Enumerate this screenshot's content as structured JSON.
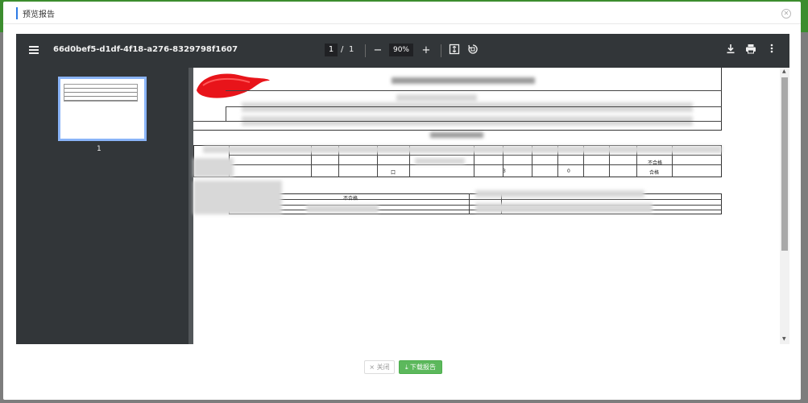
{
  "modal": {
    "title": "预览报告",
    "close_icon": "close-circle-icon"
  },
  "viewer": {
    "filename": "66d0bef5-d1df-4f18-a276-8329798f1607",
    "current_page": "1",
    "page_separator": "/",
    "total_pages": "1",
    "zoom": "90%",
    "thumbnail_label": "1",
    "icons": {
      "menu": "menu-icon",
      "zoom_out": "minus-icon",
      "zoom_in": "plus-icon",
      "fit": "fit-page-icon",
      "rotate": "rotate-icon",
      "download": "download-icon",
      "print": "print-icon",
      "more": "more-vert-icon"
    }
  },
  "document": {
    "cells": [
      "口",
      "3",
      "0",
      "不合格",
      "合格",
      "不合格"
    ]
  },
  "footer": {
    "close_label": "× 关闭",
    "download_label": "⤓ 下载报告"
  },
  "colors": {
    "accent_blue": "#2d7be5",
    "download_green": "#5cb85c",
    "viewer_toolbar": "#323639",
    "thumb_highlight": "#8ab4f8"
  }
}
